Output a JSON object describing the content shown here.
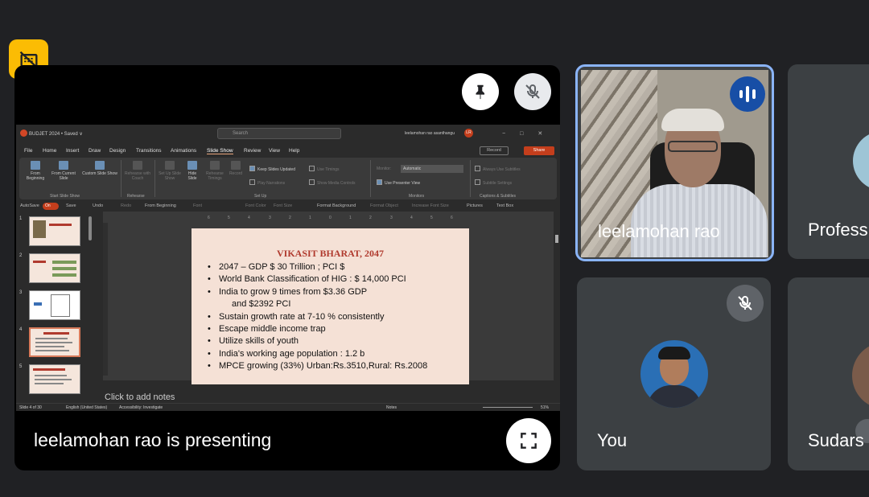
{
  "badge": {
    "icon": "screen-share-off-icon",
    "color": "#fbbc04"
  },
  "main": {
    "presenting_text": "leelamohan rao is presenting",
    "pin_icon": "pin-icon",
    "mute_icon": "mic-off-icon",
    "fullscreen_icon": "fullscreen-icon"
  },
  "ppt": {
    "file_title": "BUDJET 2024 • Saved ∨",
    "search_placeholder": "Search",
    "user": "leelamohan rao asanthangu",
    "user_initials": "LR",
    "menu": [
      "File",
      "Home",
      "Insert",
      "Draw",
      "Design",
      "Transitions",
      "Animations",
      "Slide Show",
      "Review",
      "View",
      "Help"
    ],
    "record_label": "Record",
    "share_label": "Share",
    "ribbon": {
      "from_beginning": "From Beginning",
      "from_current": "From Current Slide",
      "custom_show": "Custom Slide Show",
      "rehearse_coach": "Rehearse with Coach",
      "set_up": "Set Up Slide Show",
      "hide_slide": "Hide Slide",
      "rehearse_timings": "Rehearse Timings",
      "record": "Record",
      "keep_updated": "Keep Slides Updated",
      "play_narrations": "Play Narrations",
      "use_timings": "Use Timings",
      "show_media": "Show Media Controls",
      "monitor_label": "Monitor:",
      "monitor_value": "Automatic",
      "use_presenter": "Use Presenter View",
      "always_subtitles": "Always Use Subtitles",
      "subtitle_settings": "Subtitle Settings",
      "groups": [
        "Start Slide Show",
        "Rehearse",
        "Set Up",
        "Monitors",
        "Captions & Subtitles"
      ]
    },
    "qat": [
      "AutoSave",
      "On",
      "Save",
      "Undo",
      "Redo",
      "From Beginning",
      "Font",
      "Font Color",
      "Font Size",
      "Format Background",
      "Format Object",
      "Increase Font Size",
      "Pictures",
      "Text Box"
    ],
    "ruler": [
      "6",
      "5",
      "4",
      "3",
      "2",
      "1",
      "0",
      "1",
      "2",
      "3",
      "4",
      "5",
      "6"
    ],
    "thumbs": [
      "1",
      "2",
      "3",
      "4",
      "5"
    ],
    "slide": {
      "title": "VIKASIT BHARAT, 2047",
      "bullets": [
        "2047 – GDP $ 30 Trillion ; PCI $",
        "World Bank Classification of HIG : $ 14,000 PCI",
        "India to grow 9 times from $3.36 GDP",
        "and $2392 PCI",
        "Sustain growth rate at 7-10 % consistently",
        "Escape middle income trap",
        "Utilize skills of youth",
        "India's working age population : 1.2 b",
        "MPCE growing (33%)  Urban:Rs.3510,Rural: Rs.2008"
      ]
    },
    "notes_placeholder": "Click to add notes",
    "status": {
      "slide": "Slide 4 of 30",
      "language": "English (United States)",
      "accessibility": "Accessibility: Investigate",
      "notes": "Notes",
      "zoom": "51%"
    }
  },
  "tiles": {
    "presenter": {
      "name": "leelamohan rao",
      "speaking_icon": "audio-level-icon",
      "accent": "#8ab4f8"
    },
    "prof": {
      "name": "Profess"
    },
    "you": {
      "name": "You",
      "mute_icon": "mic-off-icon"
    },
    "sud": {
      "name": "Sudars"
    }
  }
}
